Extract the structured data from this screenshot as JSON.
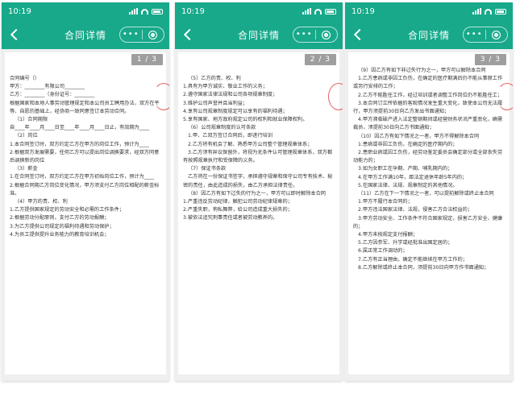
{
  "status": {
    "time": "10:19"
  },
  "nav": {
    "title": "合同详情",
    "more": "•••"
  },
  "pages": [
    {
      "indicator": "1 / 3",
      "lines": [
        "合同编号（）",
        "甲方：________有限公司________",
        "乙方：________（身份证号：________",
        "根据国家和本地人事劳动管理规定和本公司员工聘用办法，双方在平等、自愿的基础上，经协商一致同意签订本劳动合同。",
        "（1）合同期限",
        "自____年____月____日至____年____月____日止，有效期为____",
        "（2）岗位",
        "1.本合同签订时，双方约定乙方在甲方的岗位工作，预计为____",
        "2.根据双方发展需要，任何乙方可以提出岗位调换要求，经双方同意后调换新的岗位",
        "（3）薪金",
        "1.在合同签订时，双方约定乙方在甲方初始岗位工作，预计为____",
        "2.根据合同期乙方岗位变化情况，甲方须支付乙方岗位相配的薪金标准。",
        "（4）甲方的责、权、利",
        "1.乙方提供国家规定的劳动安全和必需的工作条件；",
        "2.根据劳动分配原则，支付乙方的劳动报酬；",
        "3.为乙方提供公司规定的福利待遇和劳动保护；",
        "4.为员工提供提升业务能力的教育培训机会；"
      ]
    },
    {
      "indicator": "2 / 3",
      "lines": [
        "（5）乙方的责、权、利",
        "1.具有为甲方诚实、敬业工作的义务；",
        "2.遵守国家法律法规和公司各项规章制度；",
        "3.维护公司声誉并且当利益；",
        "4.享有公司规章制度规定可以享有的福利待遇；",
        "5.享有国家、地方政府规定公司的权利和就业保障权利。",
        "（6）公司规章制度的认可条款",
        "1.甲、乙双方签订合同后，即进行培训",
        "2.乙方将有机会了解、熟悉甲方公司整个管理规章体系；",
        "3.乙方须有异议保留外，将视为无条件认可管理规章体系，双方都有按照规章执行和受保障的义务。",
        "（7）保证书条款",
        "乙方将在一份保证书签字，承担遵守规章和保守公司专有技术、秘密的责任，由此造成的损失，由乙方承担法律责任。",
        "（8）因乙方有如下过失的行为之一，甲方可以即时解除本合同",
        "1.严重违反劳动纪律，触犯公司劳动纪律规章的；",
        "2.严重失职，徇私舞弊，给公司造成重大损失的；",
        "3.被依法追究刑事责任或者被劳动教养的。"
      ]
    },
    {
      "indicator": "3 / 3",
      "lines": [
        "（9）因乙方有如下非过失行为之一，甲方可以解除本合同",
        "1.乙方患病或非因工负伤，在确定的医疗期满后仍不能从事原工作或另行安排的工作；",
        "2.乙方不能胜任工作，经过培训或者调整工作岗位仍不能胜任工；",
        "3.本合同订立所依据的客观情况发生重大变化，致使本公司无法履行，甲方须提前30日向乙方发出书面通知；",
        "4.甲方濒临破产进入法定整顿期间或经营财务状况严重恶化，确需裁员，须提前30日向乙方书面通知；",
        "（10）因乙方有如下情况之一者，甲方不得解除本合同",
        "1.患病或非因工负伤，在确定的医疗期内的；",
        "2.患职业病或因工负伤，经劳动鉴定委员会确定部分或全部丧失劳动能力的；",
        "3.如为女职工在孕期、产期、哺乳期内的；",
        "4.在甲方工作满10年，距法定退休年龄5年内的；",
        "5.在国家法律、法规、规章制定的其他情况。",
        "（11）乙方在下一下情况之一者，可以提前解除或终止本合同",
        "1.甲方不履行本合同的；",
        "2.甲方违法国家法律、法规，侵害乙方合法权益的；",
        "3.甲方劳动安全、工作条件不符合国家规定，损害乙方安全、健康的；",
        "4.甲方未按规定支付报酬；",
        "5.乙方因参军、升学或经批准出国定居的；",
        "6.属正常工作调动的；",
        "7.乙方有正当理由，确定不能继续在甲方工作的；",
        "8.乙方解除或终止本合同，须提前30日向甲方作书面通知；"
      ]
    }
  ],
  "colors": {
    "accent": "#17a98a",
    "seal": "#e24646",
    "indicator": "#9e9e9e"
  }
}
